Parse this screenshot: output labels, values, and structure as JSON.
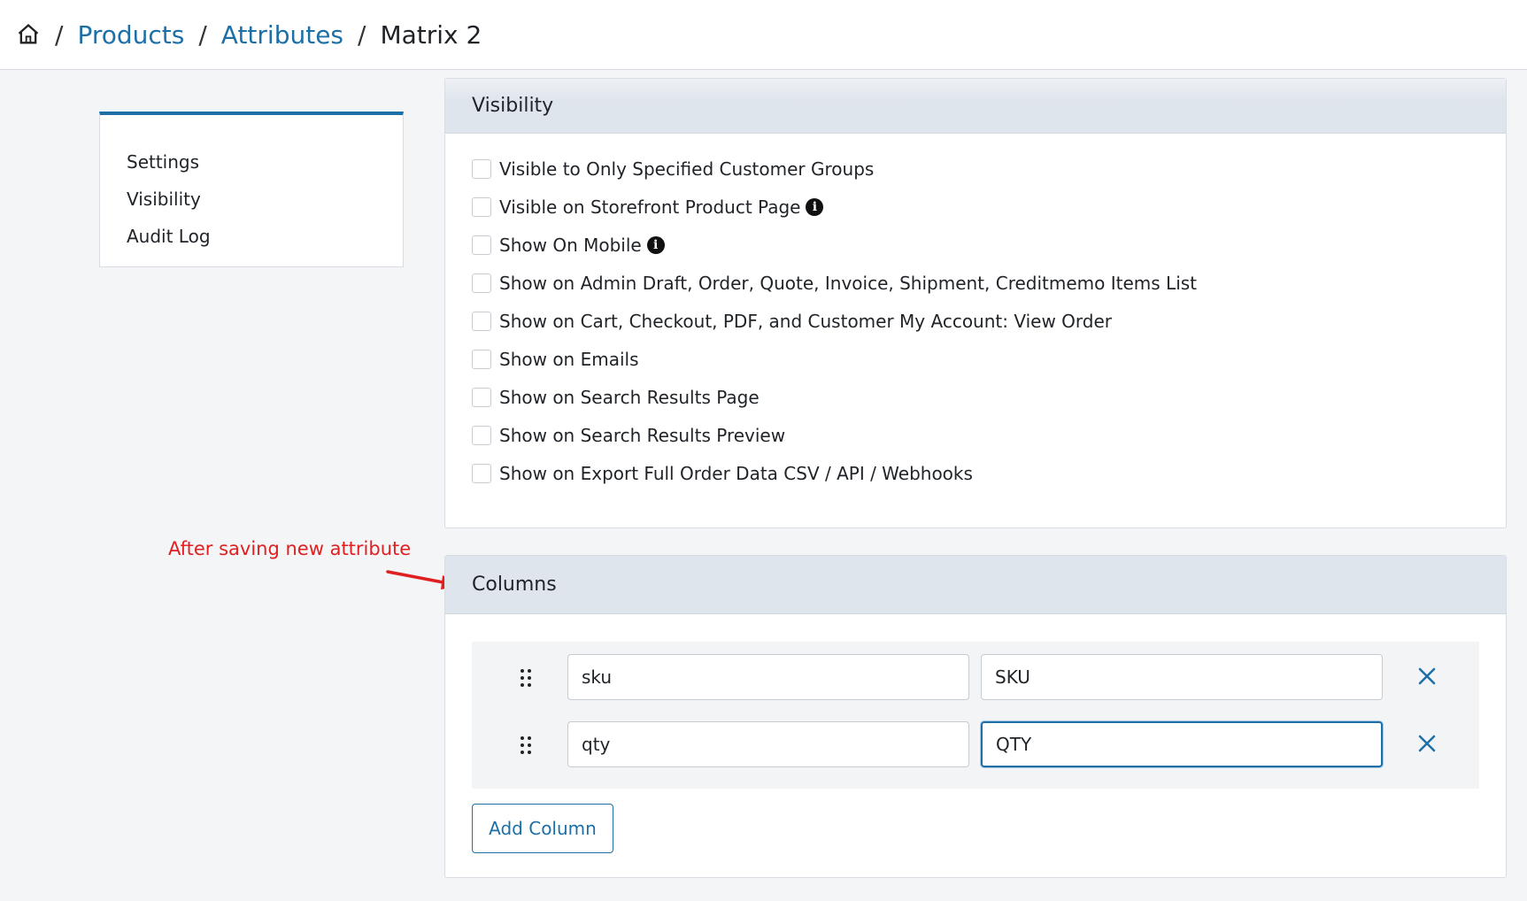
{
  "breadcrumb": {
    "home_icon": "home-icon",
    "separator": "/",
    "items": [
      "Products",
      "Attributes"
    ],
    "current": "Matrix 2"
  },
  "sidebar": {
    "items": [
      {
        "label": "Settings"
      },
      {
        "label": "Visibility"
      },
      {
        "label": "Audit Log"
      }
    ]
  },
  "visibility": {
    "title": "Visibility",
    "options": [
      {
        "label": "Visible to Only Specified Customer Groups",
        "info": false
      },
      {
        "label": "Visible on Storefront Product Page",
        "info": true
      },
      {
        "label": "Show On Mobile",
        "info": true
      },
      {
        "label": "Show on Admin Draft, Order, Quote, Invoice, Shipment, Creditmemo Items List",
        "info": false
      },
      {
        "label": "Show on Cart, Checkout, PDF, and Customer My Account: View Order",
        "info": false
      },
      {
        "label": "Show on Emails",
        "info": false
      },
      {
        "label": "Show on Search Results Page",
        "info": false
      },
      {
        "label": "Show on Search Results Preview",
        "info": false
      },
      {
        "label": "Show on Export Full Order Data CSV / API / Webhooks",
        "info": false
      }
    ]
  },
  "columns": {
    "title": "Columns",
    "rows": [
      {
        "key": "sku",
        "label": "SKU"
      },
      {
        "key": "qty",
        "label": "QTY"
      }
    ],
    "add_label": "Add Column"
  },
  "annotation": {
    "text": "After saving new attribute",
    "color": "#e02020"
  },
  "colors": {
    "accent": "#1d6fa8",
    "panel_header": "#dfe5ec"
  }
}
